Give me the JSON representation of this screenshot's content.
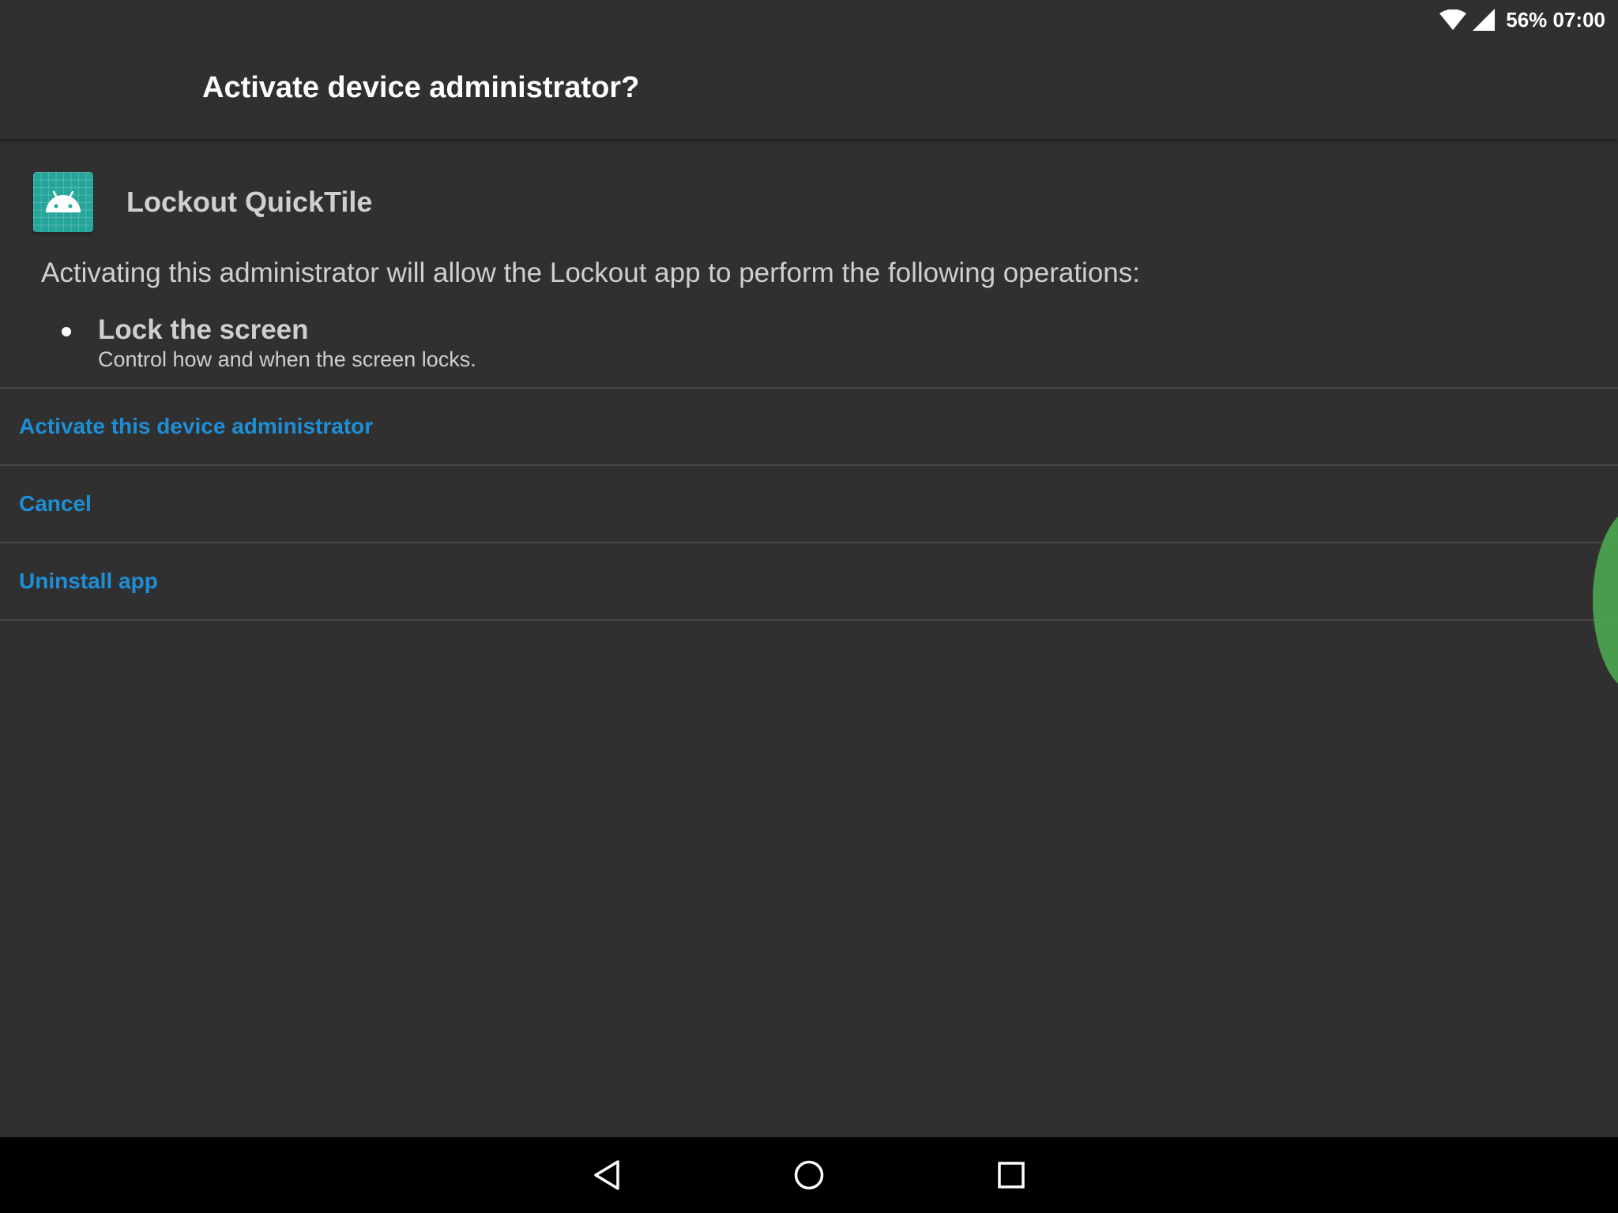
{
  "status_bar": {
    "battery_time": "56% 07:00",
    "icons": [
      "wifi-icon",
      "cell-signal-icon"
    ]
  },
  "toolbar": {
    "title": "Activate device administrator?"
  },
  "app": {
    "name": "Lockout QuickTile",
    "icon": "android-icon",
    "icon_color": "#26a69a"
  },
  "description": "Activating this administrator will allow the Lockout app to perform the following operations:",
  "policies": [
    {
      "title": "Lock the screen",
      "description": "Control how and when the screen locks."
    }
  ],
  "actions": [
    {
      "label": "Activate this device administrator"
    },
    {
      "label": "Cancel"
    },
    {
      "label": "Uninstall app"
    }
  ],
  "navigation": {
    "icons": [
      "back-icon",
      "home-icon",
      "recents-icon"
    ]
  },
  "colors": {
    "background": "#303030",
    "accent": "#1e8fd6",
    "nav_bar": "#000000"
  }
}
